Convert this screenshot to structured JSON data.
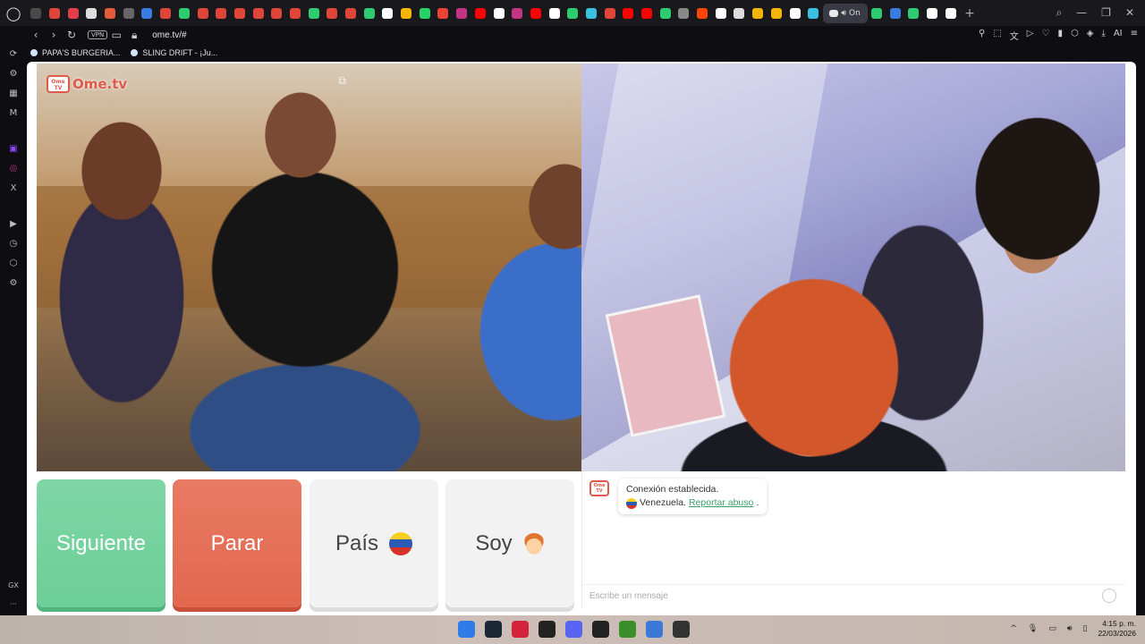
{
  "browser": {
    "tabs": [
      {
        "icon": "tab-icon-1",
        "color": "#4a4a4a"
      },
      {
        "icon": "tab-icon-2",
        "color": "#e0453a"
      },
      {
        "icon": "tab-icon-3",
        "color": "#e23d4b"
      },
      {
        "icon": "tab-icon-4",
        "color": "#dddddd"
      },
      {
        "icon": "tab-icon-5",
        "color": "#e25b3a"
      },
      {
        "icon": "tab-icon-6",
        "color": "#666666"
      },
      {
        "icon": "tab-icon-7",
        "color": "#3a7be0"
      },
      {
        "icon": "tab-icon-8",
        "color": "#e0453a"
      },
      {
        "icon": "tab-icon-9",
        "color": "#2ecc71"
      },
      {
        "icon": "tab-icon-10",
        "color": "#e0453a"
      },
      {
        "icon": "tab-icon-11",
        "color": "#e0453a"
      },
      {
        "icon": "tab-icon-12",
        "color": "#e0453a"
      },
      {
        "icon": "tab-icon-13",
        "color": "#e0453a"
      },
      {
        "icon": "tab-icon-14",
        "color": "#e0453a"
      },
      {
        "icon": "tab-icon-15",
        "color": "#e0453a"
      },
      {
        "icon": "tab-icon-16",
        "color": "#2ecc71"
      },
      {
        "icon": "tab-icon-17",
        "color": "#e0453a"
      },
      {
        "icon": "tab-icon-18",
        "color": "#e0453a"
      },
      {
        "icon": "tab-icon-19",
        "color": "#2ecc71"
      },
      {
        "icon": "tab-icon-20",
        "color": "#ffffff"
      },
      {
        "icon": "tab-icon-21",
        "color": "#f4b400"
      },
      {
        "icon": "tab-icon-22",
        "color": "#25d366"
      },
      {
        "icon": "tab-icon-23",
        "color": "#ea4335"
      },
      {
        "icon": "tab-icon-24",
        "color": "#c13584"
      },
      {
        "icon": "tab-icon-25",
        "color": "#ff0000"
      },
      {
        "icon": "tab-icon-26",
        "color": "#ffffff"
      },
      {
        "icon": "tab-icon-27",
        "color": "#c13584"
      },
      {
        "icon": "tab-icon-28",
        "color": "#ff0000"
      },
      {
        "icon": "tab-icon-29",
        "color": "#ffffff"
      },
      {
        "icon": "tab-icon-30",
        "color": "#2ecc71"
      },
      {
        "icon": "tab-icon-31",
        "color": "#3ac0e0"
      },
      {
        "icon": "tab-icon-32",
        "color": "#e0453a"
      },
      {
        "icon": "tab-icon-33",
        "color": "#ff0000"
      },
      {
        "icon": "tab-icon-34",
        "color": "#ff0000"
      },
      {
        "icon": "tab-icon-35",
        "color": "#2ecc71"
      },
      {
        "icon": "tab-icon-36",
        "color": "#888888"
      },
      {
        "icon": "tab-icon-37",
        "color": "#ff4500"
      },
      {
        "icon": "tab-icon-38",
        "color": "#ffffff"
      },
      {
        "icon": "tab-icon-39",
        "color": "#dddddd"
      },
      {
        "icon": "tab-icon-40",
        "color": "#f4b400"
      },
      {
        "icon": "tab-icon-41",
        "color": "#f4b400"
      },
      {
        "icon": "tab-icon-42",
        "color": "#ffffff"
      },
      {
        "icon": "tab-icon-43",
        "color": "#3ac0e0"
      }
    ],
    "active_tab": {
      "label": "On",
      "icon": "ome-tv-icon",
      "audio_icon": "speaker-icon"
    },
    "after_tabs": [
      {
        "icon": "tab-icon-44",
        "color": "#2ecc71"
      },
      {
        "icon": "tab-icon-45",
        "color": "#3a7be0"
      },
      {
        "icon": "tab-icon-46",
        "color": "#2ecc71"
      },
      {
        "icon": "tab-icon-47",
        "color": "#ffffff"
      },
      {
        "icon": "tab-icon-48",
        "color": "#ffffff"
      }
    ],
    "new_tab_label": "+",
    "window_controls": {
      "search": "⌕",
      "minimize": "—",
      "restore": "❐",
      "close": "✕"
    },
    "address": {
      "vpn_label": "VPN",
      "url": "ome.tv/#",
      "back": "‹",
      "forward": "›",
      "reload": "↻",
      "aria_label": "AI"
    },
    "bookmarks": [
      {
        "label": "PAPA'S BURGERIA..."
      },
      {
        "label": "SLING DRIFT - ¡Ju..."
      }
    ],
    "sidebar_bottom": {
      "label": "GX",
      "more": "···"
    }
  },
  "page": {
    "logo_tv_text": "Ome TV",
    "logo_name": "Ome.tv",
    "buttons": {
      "next": "Siguiente",
      "stop": "Parar",
      "country": "País",
      "gender": "Soy"
    },
    "country_flag_colors": [
      "#f6cf1f",
      "#2b5bb5",
      "#d6332c"
    ],
    "chat": {
      "logo_text": "Ome TV",
      "line1": "Conexión establecida.",
      "country": "Venezuela.",
      "report_link": "Reportar abuso",
      "trailing": ".",
      "input_placeholder": "Escribe un mensaje"
    }
  },
  "taskbar": {
    "time": "4:15 p. m.",
    "date": "22/03/2026",
    "tray_arrow": "^",
    "icons": [
      {
        "name": "windows-start-icon",
        "color": "#2f7be8"
      },
      {
        "name": "steam-icon",
        "color": "#1b2838"
      },
      {
        "name": "opera-gx-icon",
        "color": "#d4213c"
      },
      {
        "name": "epic-games-icon",
        "color": "#222222"
      },
      {
        "name": "discord-icon",
        "color": "#5865f2"
      },
      {
        "name": "app-icon",
        "color": "#222222"
      },
      {
        "name": "minecraft-icon",
        "color": "#3b8f2a"
      },
      {
        "name": "app-icon-2",
        "color": "#3b78d8"
      },
      {
        "name": "app-icon-3",
        "color": "#333333"
      }
    ]
  }
}
